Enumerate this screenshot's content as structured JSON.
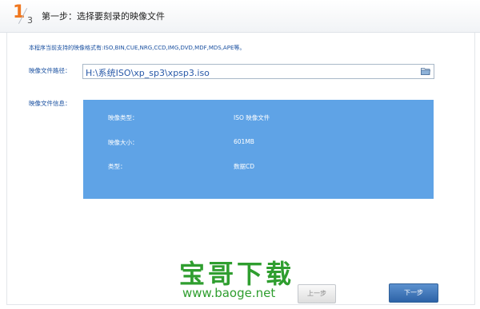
{
  "header": {
    "step_current": "1",
    "step_total": "3",
    "title": "第一步：选择要刻录的映像文件"
  },
  "note": "本程序当前支持的映像格式有:ISO,BIN,CUE,NRG,CCD,IMG,DVD,MDF,MDS,APE等。",
  "path": {
    "label": "映像文件路径：",
    "value": "H:\\系统ISO\\xp_sp3\\xpsp3.iso",
    "icon": "folder-open-icon"
  },
  "info": {
    "label": "映像文件信息：",
    "rows": [
      {
        "key": "映像类型：",
        "value": "ISO 映像文件"
      },
      {
        "key": "映像大小：",
        "value": "601MB"
      },
      {
        "key": "类型：",
        "value": "数据CD"
      }
    ]
  },
  "watermark": {
    "brand": "宝哥下载",
    "url": "www.baoge.net"
  },
  "buttons": {
    "prev": "上一步",
    "next": "下一步"
  },
  "colors": {
    "accent_orange": "#f07820",
    "panel_blue": "#5fa3e6",
    "label_blue": "#1a50a0",
    "watermark_green": "#2f9e2f"
  }
}
